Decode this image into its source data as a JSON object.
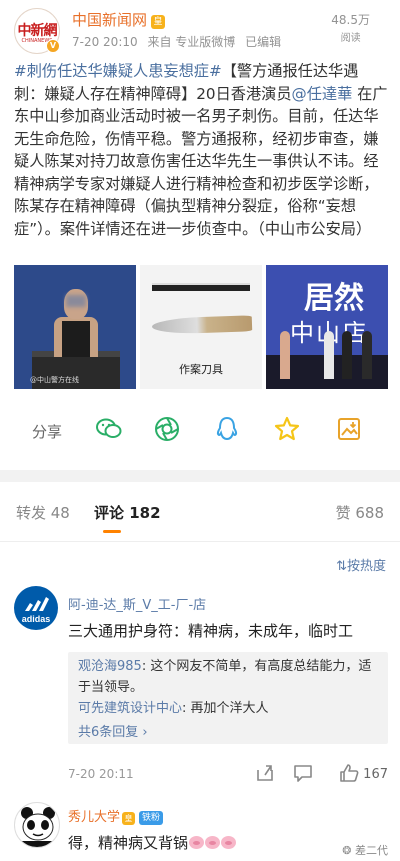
{
  "post": {
    "account": {
      "name": "中国新闻网",
      "logo_text": "中新網",
      "logo_sub": "CHINANEWS",
      "verified": "V",
      "crown": "皇"
    },
    "meta": {
      "time": "7-20 20:10",
      "source": "来自 专业版微博",
      "edited": "已编辑"
    },
    "reads": {
      "count": "48.5万",
      "label": "阅读"
    },
    "text": {
      "topic": "#刺伤任达华嫌疑人患妄想症#",
      "part1": "【警方通报任达华遇刺：嫌疑人存在精神障碍】20日香港演员",
      "mention": "@任達華",
      "part2": " 在广东中山参加商业活动时被一名男子刺伤。目前，任达华无生命危险，伤情平稳。警方通报称，经初步审查，嫌疑人陈某对持刀故意伤害任达华先生一事供认不讳。经精神病学专家对嫌疑人进行精神检查和初步医学诊断，陈某存在精神障碍（偏执型精神分裂症，俗称“妄想症”）。案件详情还在进一步侦查中。（中山市公安局）"
    },
    "photos": {
      "photo1_watermark": "@中山警方在线",
      "photo2_caption": "作案刀具",
      "photo3_sign_top": "居然",
      "photo3_sign_bottom": "中山店"
    },
    "share": {
      "label": "分享",
      "icons": [
        "wechat-icon",
        "moments-icon",
        "qq-icon",
        "qzone-icon",
        "save-image-icon"
      ]
    }
  },
  "tabs": {
    "repost": "转发 48",
    "comments": "评论 182",
    "likes": "赞 688"
  },
  "sort_label": "按热度",
  "comment1": {
    "name": "阿-迪-达_斯_V_工-厂-店",
    "avatar_text": "adidas",
    "text": "三大通用护身符：精神病，未成年，临时工",
    "replies": [
      {
        "name": "观沧海985",
        "text": ": 这个网友不简单，有高度总结能力，适于当领导。"
      },
      {
        "name": "可先建筑设计中心",
        "text": ": 再加个洋大人"
      }
    ],
    "more_replies": "共6条回复",
    "time": "7-20 20:11",
    "likes": "167"
  },
  "comment2": {
    "name": "秀儿大学",
    "badge": "铁粉",
    "crown": "皇",
    "text": "得，精神病又背锅"
  },
  "watermark": "差二代",
  "colors": {
    "orange_name": "#e8702a",
    "link_blue": "#4a6f9f",
    "tab_underline": "#ff8200",
    "wechat_green": "#2aae67",
    "star_yellow": "#f5c518"
  }
}
